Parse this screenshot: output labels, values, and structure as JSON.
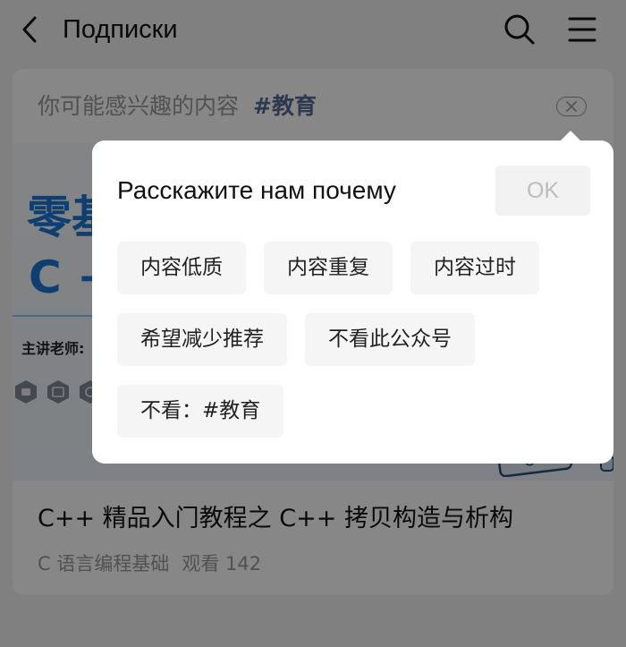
{
  "header": {
    "title": "Подписки",
    "icons": {
      "back": "chevron-left-icon",
      "search": "search-icon",
      "menu": "menu-icon"
    }
  },
  "feed_card": {
    "recommend_label": "你可能感兴趣的内容",
    "recommend_tag": "#教育",
    "close_icon": "close-icon",
    "banner": {
      "headline_line1": "零基",
      "headline_line2": "C +",
      "teacher_label": "主讲老师:"
    },
    "title": "C++ 精品入门教程之 C++ 拷贝构造与析构",
    "source": "C 语言编程基础",
    "views": "观看 142"
  },
  "feedback_dialog": {
    "title": "Расскажите нам почему",
    "ok_label": "OK",
    "reasons": [
      "内容低质",
      "内容重复",
      "内容过时",
      "希望减少推荐",
      "不看此公众号",
      "不看：#教育"
    ]
  },
  "colors": {
    "page_bg": "#f2f2f2",
    "tag_accent": "#576b95",
    "banner_blue": "#1e78d6",
    "ok_disabled_text": "#bdbdbd",
    "chip_bg": "#f5f5f5",
    "overlay": "#000000"
  }
}
